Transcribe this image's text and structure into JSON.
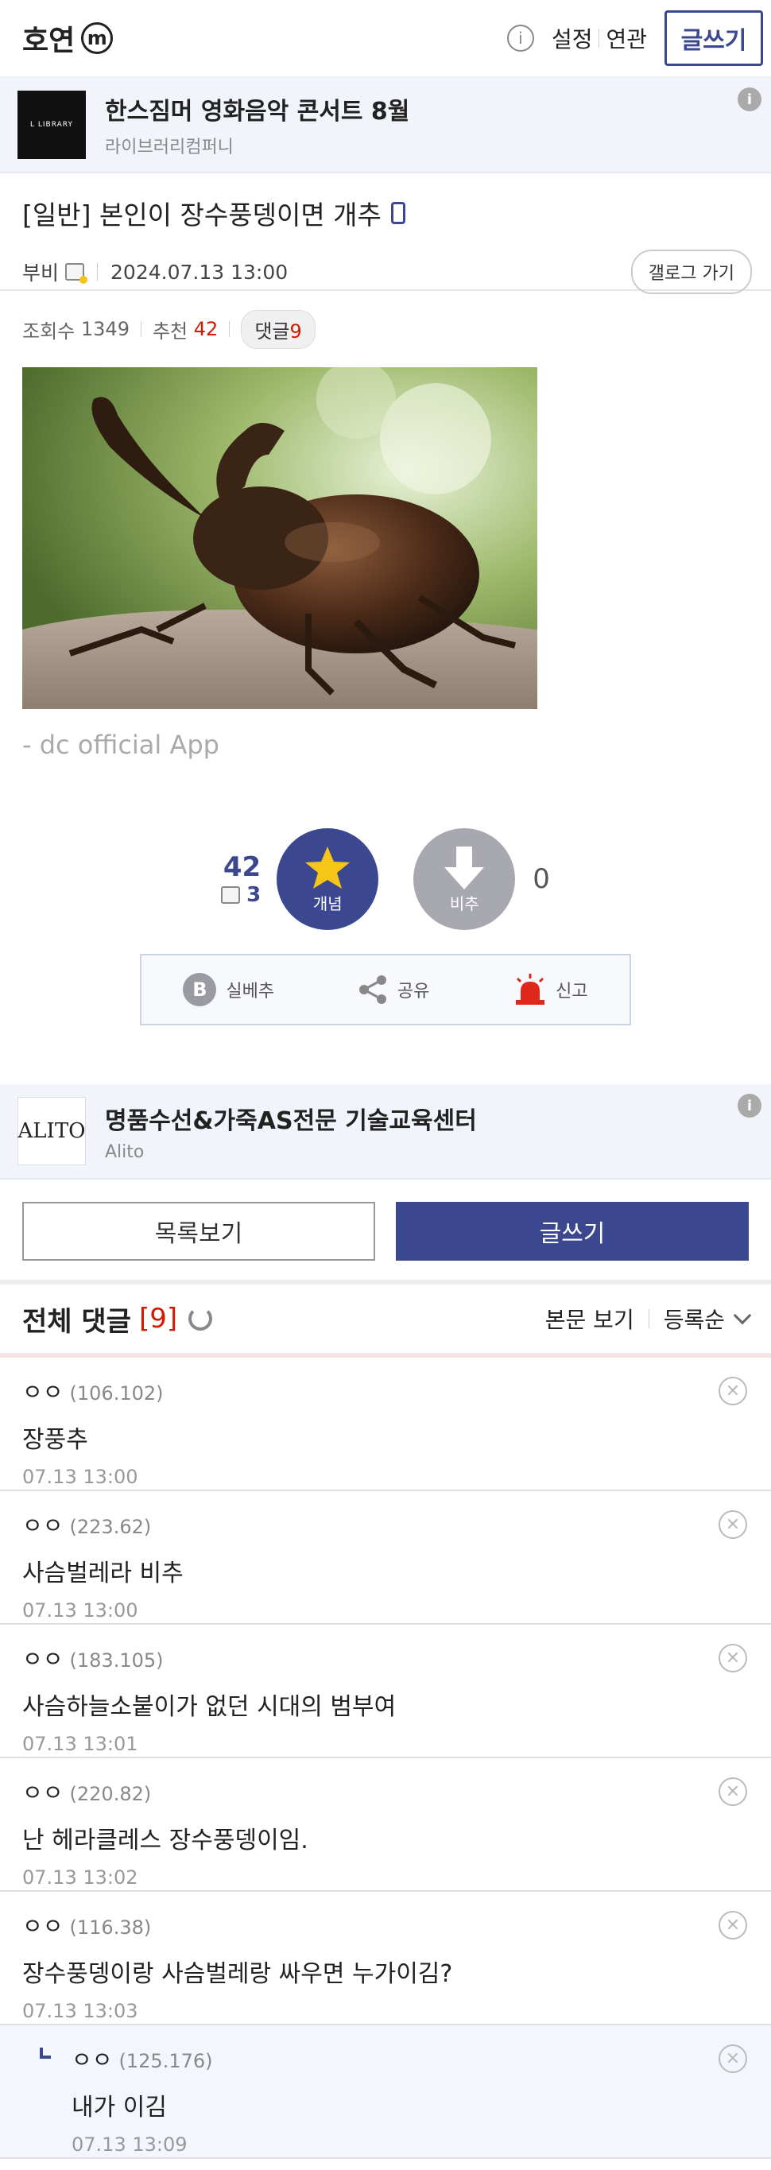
{
  "header": {
    "gallery_name": "호연",
    "m_badge": "m",
    "info_glyph": "i",
    "settings": "설정",
    "related": "연관",
    "write": "글쓰기"
  },
  "ad_top": {
    "logo_text": "L LIBRARY",
    "title": "한스짐머 영화음악 콘서트 8월",
    "sub": "라이브러리컴퍼니",
    "info_glyph": "i"
  },
  "post": {
    "title": "[일반] 본인이 장수풍뎅이면 개추",
    "author": "부비",
    "date": "2024.07.13 13:00",
    "gallery_btn": "갤로그 가기",
    "views_label": "조회수",
    "views": "1349",
    "recommend_label": "추천",
    "recommend": "42",
    "comments_label": "댓글",
    "comments": "9",
    "signature": "- dc official App"
  },
  "vote": {
    "up_count": "42",
    "fixed_count": "3",
    "up_label": "개념",
    "down_label": "비추",
    "down_count": "0"
  },
  "actions": {
    "real_best": "실베추",
    "b_glyph": "B",
    "share": "공유",
    "report": "신고"
  },
  "ad_bottom": {
    "logo_text": "ALITO",
    "title": "명품수선&가죽AS전문 기술교육센터",
    "sub": "Alito",
    "info_glyph": "i"
  },
  "buttons": {
    "list": "목록보기",
    "write": "글쓰기"
  },
  "comment_section": {
    "title": "전체 댓글",
    "count": "[9]",
    "view_body": "본문 보기",
    "sort": "등록순"
  },
  "comments": [
    {
      "nick": "ㅇㅇ",
      "ip": "(106.102)",
      "text": "장풍추",
      "time": "07.13 13:00",
      "del": "✕"
    },
    {
      "nick": "ㅇㅇ",
      "ip": "(223.62)",
      "text": "사슴벌레라 비추",
      "time": "07.13 13:00",
      "del": "✕"
    },
    {
      "nick": "ㅇㅇ",
      "ip": "(183.105)",
      "text": "사슴하늘소붙이가 없던 시대의 범부여",
      "time": "07.13 13:01",
      "del": "✕"
    },
    {
      "nick": "ㅇㅇ",
      "ip": "(220.82)",
      "text": "난 헤라클레스 장수풍뎅이임.",
      "time": "07.13 13:02",
      "del": "✕"
    },
    {
      "nick": "ㅇㅇ",
      "ip": "(116.38)",
      "text": "장수풍뎅이랑 사슴벌레랑 싸우면 누가이김?",
      "time": "07.13 13:03",
      "del": "✕"
    }
  ],
  "reply": {
    "nick": "ㅇㅇ",
    "ip": "(125.176)",
    "text": "내가 이김",
    "time": "07.13 13:09",
    "del": "✕"
  }
}
